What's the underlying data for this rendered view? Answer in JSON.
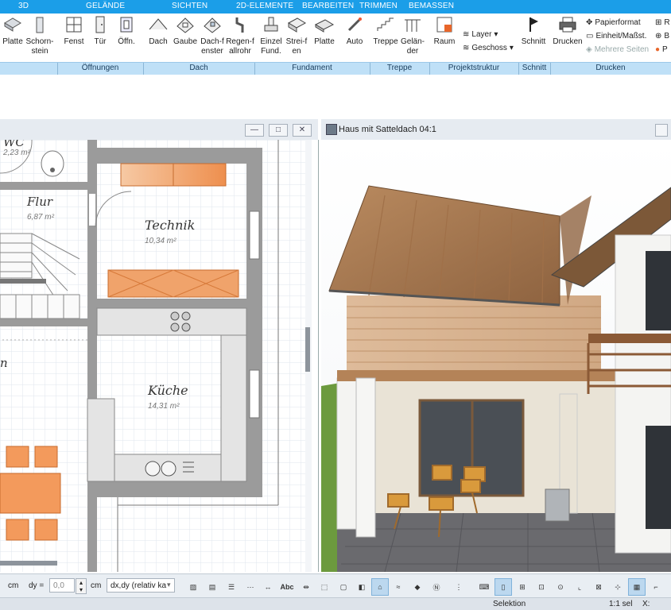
{
  "tabs": [
    "3D",
    "GELÄNDE",
    "SICHTEN",
    "2D-ELEMENTE",
    "BEARBEITEN",
    "TRIMMEN",
    "BEMASSEN"
  ],
  "ribbon": {
    "platte1": "Platte",
    "schornstein": "Schorn-stein",
    "fenst": "Fenst",
    "tuer": "Tür",
    "oeffn": "Öffn.",
    "dach": "Dach",
    "gaube": "Gaube",
    "dachfenster": "Dach-fenster",
    "regenfallrohr": "Regen-fallrohr",
    "einzel": "Einzel Fund.",
    "streifen": "Strei-fen",
    "platte2": "Platte",
    "auto": "Auto",
    "treppe": "Treppe",
    "gelaender": "Gelän-der",
    "raum": "Raum",
    "layer": "Layer",
    "geschoss": "Geschoss",
    "schnitt": "Schnitt",
    "drucken": "Drucken",
    "papierformat": "Papierformat",
    "einheit": "Einheit/Maßst.",
    "mehrere": "Mehrere Seiten",
    "r_label": "R",
    "b_label": "B",
    "p_label": "P"
  },
  "groups": {
    "oeffnungen": "Öffnungen",
    "dach": "Dach",
    "fundament": "Fundament",
    "treppe": "Treppe",
    "projektstruktur": "Projektstruktur",
    "schnitt": "Schnitt",
    "drucken": "Drucken"
  },
  "plan": {
    "rooms": [
      {
        "name": "Flur",
        "area": "6,87 m²"
      },
      {
        "name": "Technik",
        "area": "10,34 m²"
      },
      {
        "name": "Küche",
        "area": "14,31 m²"
      }
    ],
    "wc_area": "2,23 m²",
    "wc_name": "WC",
    "partial_label": "n"
  },
  "view3d": {
    "title": "Haus mit Satteldach 04:1"
  },
  "bottombar": {
    "unit1": "cm",
    "dy_label": "dy =",
    "dy_value": "0,0",
    "unit2": "cm",
    "mode": "dx,dy (relativ ka",
    "abc": "Abc"
  },
  "status": {
    "mode": "Selektion",
    "scale": "1:1 sel",
    "x_label": "X:"
  }
}
